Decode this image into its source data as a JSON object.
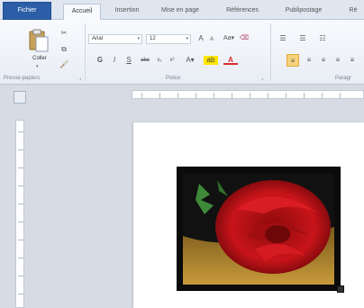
{
  "ribbon": {
    "tabs": [
      {
        "label": "Fichier",
        "type": "file"
      },
      {
        "label": "Accueil",
        "type": "active"
      },
      {
        "label": "Insertion",
        "type": "normal"
      },
      {
        "label": "Mise en page",
        "type": "normal"
      },
      {
        "label": "Références",
        "type": "normal"
      },
      {
        "label": "Publipostage",
        "type": "normal"
      },
      {
        "label": "Ré",
        "type": "normal"
      }
    ],
    "clipboard": {
      "paste_label": "Coller",
      "group_label": "Presse-papiers"
    },
    "font": {
      "family": "Arial",
      "size": "12",
      "group_label": "Police"
    },
    "paragraph": {
      "group_label": "Paragr"
    }
  },
  "colors": {
    "file_tab": "#2b5ea7",
    "highlight": "#ffe600",
    "font_color": "#d92b2b",
    "active_align": "#f6d37a"
  }
}
